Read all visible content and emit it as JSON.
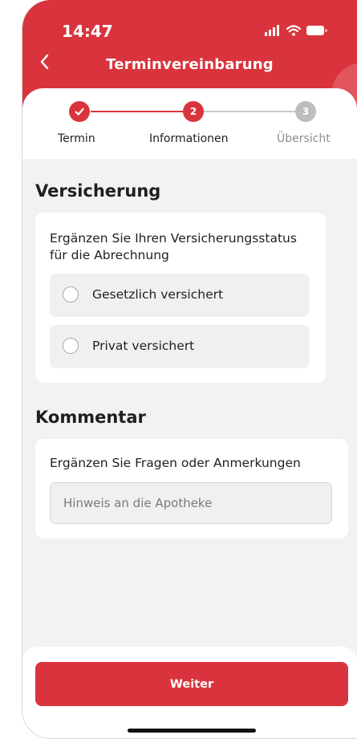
{
  "status_bar": {
    "time": "14:47"
  },
  "header": {
    "title": "Terminvereinbarung"
  },
  "stepper": {
    "steps": [
      {
        "label": "Termin",
        "number": "",
        "state": "done"
      },
      {
        "label": "Informationen",
        "number": "2",
        "state": "active"
      },
      {
        "label": "Übersicht",
        "number": "3",
        "state": "pending"
      }
    ]
  },
  "insurance": {
    "section_title": "Versicherung",
    "prompt": "Ergänzen Sie Ihren Versicherungsstatus für die Abrechnung",
    "options": [
      {
        "label": "Gesetzlich versichert",
        "selected": false
      },
      {
        "label": "Privat versichert",
        "selected": false
      }
    ]
  },
  "comment": {
    "section_title": "Kommentar",
    "prompt": "Ergänzen Sie Fragen oder Anmerkungen",
    "placeholder": "Hinweis an die Apotheke",
    "value": ""
  },
  "footer": {
    "button_label": "Weiter"
  },
  "colors": {
    "brand_red": "#d9343d",
    "inactive_grey": "#bdbdbd",
    "background": "#f2f2f2"
  },
  "icons": [
    "back-chevron-icon",
    "signal-icon",
    "wifi-icon",
    "battery-icon",
    "check-icon",
    "radio-icon"
  ]
}
